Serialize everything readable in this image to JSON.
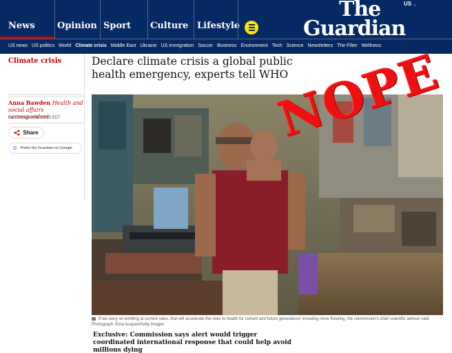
{
  "masthead": {
    "pillars": [
      {
        "label": "News",
        "active": true
      },
      {
        "label": "Opinion",
        "active": false
      },
      {
        "label": "Sport",
        "active": false
      },
      {
        "label": "Culture",
        "active": false
      },
      {
        "label": "Lifestyle",
        "active": false
      }
    ],
    "logo_line1": "The",
    "logo_line2": "Guardian",
    "edition": "US",
    "more_icon": "hamburger-icon",
    "colors": {
      "brand": "#052962",
      "accent": "#c70000",
      "highlight": "#ffe500"
    }
  },
  "subnav": {
    "items": [
      "US news",
      "US politics",
      "World",
      "Climate crisis",
      "Middle East",
      "Ukraine",
      "US immigration",
      "Soccer",
      "Business",
      "Environment",
      "Tech",
      "Science",
      "Newsletters",
      "The Filter",
      "Wellness"
    ],
    "active": "Climate crisis"
  },
  "article": {
    "section": "Climate crisis",
    "headline": "Declare climate crisis a global public health emergency, experts tell WHO",
    "author": "Anna Bawden",
    "role": "Health and social affairs correspondent",
    "date": "Sat 16 May 2026 00.00 EDT",
    "share_label": "Share",
    "share_icon": "share-icon",
    "google_label": "Prefer the Guardian on Google",
    "google_icon": "google-icon",
    "caption": "'If we carry on emitting at current rates, that will accelerate the risks to health for current and future generations' including more flooding, the commission's chief scientific adviser said. Photograph: Ezra Acayan/Getty Images",
    "caption_icon": "camera-icon",
    "standfirst": "Exclusive: Commission says alert would trigger coordinated international response that could help avoid millions dying"
  },
  "overlay": {
    "stamp_text": "NOPE",
    "stamp_color": "#ee1010"
  }
}
